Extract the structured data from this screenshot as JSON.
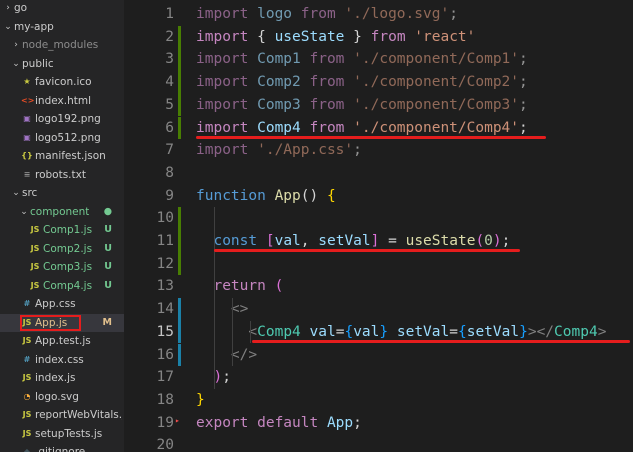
{
  "explorer": {
    "items": [
      {
        "label": "go",
        "type": "folder",
        "depth": 0,
        "expanded": false,
        "color": "#cccccc"
      },
      {
        "label": "my-app",
        "type": "folder",
        "depth": 0,
        "expanded": true,
        "color": "#cccccc"
      },
      {
        "label": "node_modules",
        "type": "folder",
        "depth": 1,
        "expanded": false,
        "color": "#8c8c8c"
      },
      {
        "label": "public",
        "type": "folder",
        "depth": 1,
        "expanded": true,
        "color": "#cccccc"
      },
      {
        "label": "favicon.ico",
        "type": "file",
        "icon": "star-icon",
        "glyph": "★",
        "iconColor": "#cbcb41",
        "depth": 2,
        "color": "#cccccc"
      },
      {
        "label": "index.html",
        "type": "file",
        "icon": "html-icon",
        "glyph": "<>",
        "iconColor": "#e44d26",
        "depth": 2,
        "color": "#cccccc"
      },
      {
        "label": "logo192.png",
        "type": "file",
        "icon": "image-icon",
        "glyph": "▣",
        "iconColor": "#a074c4",
        "depth": 2,
        "color": "#cccccc"
      },
      {
        "label": "logo512.png",
        "type": "file",
        "icon": "image-icon",
        "glyph": "▣",
        "iconColor": "#a074c4",
        "depth": 2,
        "color": "#cccccc"
      },
      {
        "label": "manifest.json",
        "type": "file",
        "icon": "json-icon",
        "glyph": "{}",
        "iconColor": "#cbcb41",
        "depth": 2,
        "color": "#cccccc"
      },
      {
        "label": "robots.txt",
        "type": "file",
        "icon": "text-icon",
        "glyph": "≡",
        "iconColor": "#8c8c8c",
        "depth": 2,
        "color": "#cccccc"
      },
      {
        "label": "src",
        "type": "folder",
        "depth": 1,
        "expanded": true,
        "color": "#cccccc"
      },
      {
        "label": "component",
        "type": "folder",
        "depth": 2,
        "expanded": true,
        "color": "#73c991",
        "badge": "●",
        "badgeColor": "#73c991"
      },
      {
        "label": "Comp1.js",
        "type": "file",
        "icon": "js-icon",
        "glyph": "JS",
        "iconColor": "#cbcb41",
        "depth": 3,
        "color": "#73c991",
        "badge": "U",
        "badgeColor": "#73c991"
      },
      {
        "label": "Comp2.js",
        "type": "file",
        "icon": "js-icon",
        "glyph": "JS",
        "iconColor": "#cbcb41",
        "depth": 3,
        "color": "#73c991",
        "badge": "U",
        "badgeColor": "#73c991"
      },
      {
        "label": "Comp3.js",
        "type": "file",
        "icon": "js-icon",
        "glyph": "JS",
        "iconColor": "#cbcb41",
        "depth": 3,
        "color": "#73c991",
        "badge": "U",
        "badgeColor": "#73c991"
      },
      {
        "label": "Comp4.js",
        "type": "file",
        "icon": "js-icon",
        "glyph": "JS",
        "iconColor": "#cbcb41",
        "depth": 3,
        "color": "#73c991",
        "badge": "U",
        "badgeColor": "#73c991"
      },
      {
        "label": "App.css",
        "type": "file",
        "icon": "css-icon",
        "glyph": "#",
        "iconColor": "#519aba",
        "depth": 2,
        "color": "#cccccc"
      },
      {
        "label": "App.js",
        "type": "file",
        "icon": "js-icon",
        "glyph": "JS",
        "iconColor": "#cbcb41",
        "depth": 2,
        "color": "#e2c08d",
        "badge": "M",
        "badgeColor": "#e2c08d",
        "selected": true,
        "highlight": true
      },
      {
        "label": "App.test.js",
        "type": "file",
        "icon": "js-icon",
        "glyph": "JS",
        "iconColor": "#cbcb41",
        "depth": 2,
        "color": "#cccccc"
      },
      {
        "label": "index.css",
        "type": "file",
        "icon": "css-icon",
        "glyph": "#",
        "iconColor": "#519aba",
        "depth": 2,
        "color": "#cccccc"
      },
      {
        "label": "index.js",
        "type": "file",
        "icon": "js-icon",
        "glyph": "JS",
        "iconColor": "#cbcb41",
        "depth": 2,
        "color": "#cccccc"
      },
      {
        "label": "logo.svg",
        "type": "file",
        "icon": "svg-icon",
        "glyph": "◔",
        "iconColor": "#ffb13b",
        "depth": 2,
        "color": "#cccccc"
      },
      {
        "label": "reportWebVitals.js",
        "type": "file",
        "icon": "js-icon",
        "glyph": "JS",
        "iconColor": "#cbcb41",
        "depth": 2,
        "color": "#cccccc"
      },
      {
        "label": "setupTests.js",
        "type": "file",
        "icon": "js-icon",
        "glyph": "JS",
        "iconColor": "#cbcb41",
        "depth": 2,
        "color": "#cccccc"
      },
      {
        "label": ".gitignore",
        "type": "file",
        "icon": "git-icon",
        "glyph": "◆",
        "iconColor": "#41535b",
        "depth": 2,
        "color": "#cccccc"
      }
    ]
  },
  "editor": {
    "current_line": 15,
    "lines": [
      {
        "n": "1",
        "tokens": [
          [
            "import ",
            "kw",
            "0.65"
          ],
          [
            "logo",
            "id",
            "0.65"
          ],
          [
            " from ",
            "kw",
            "0.65"
          ],
          [
            "'./logo.svg'",
            "str",
            "0.65"
          ],
          [
            ";",
            "pl",
            "0.65"
          ]
        ]
      },
      {
        "n": "2",
        "gutter": "added",
        "tokens": [
          [
            "import ",
            "kw"
          ],
          [
            "{ ",
            "pl"
          ],
          [
            "useState",
            "id"
          ],
          [
            " } ",
            "pl"
          ],
          [
            "from ",
            "kw"
          ],
          [
            "'react'",
            "str"
          ]
        ]
      },
      {
        "n": "3",
        "gutter": "added",
        "tokens": [
          [
            "import ",
            "kw",
            "0.65"
          ],
          [
            "Comp1",
            "id",
            "0.65"
          ],
          [
            " from ",
            "kw",
            "0.65"
          ],
          [
            "'./component/Comp1'",
            "str",
            "0.65"
          ],
          [
            ";",
            "pl",
            "0.65"
          ]
        ]
      },
      {
        "n": "4",
        "gutter": "added",
        "tokens": [
          [
            "import ",
            "kw",
            "0.65"
          ],
          [
            "Comp2",
            "id",
            "0.65"
          ],
          [
            " from ",
            "kw",
            "0.65"
          ],
          [
            "'./component/Comp2'",
            "str",
            "0.65"
          ],
          [
            ";",
            "pl",
            "0.65"
          ]
        ]
      },
      {
        "n": "5",
        "gutter": "added",
        "tokens": [
          [
            "import ",
            "kw",
            "0.65"
          ],
          [
            "Comp3",
            "id",
            "0.65"
          ],
          [
            " from ",
            "kw",
            "0.65"
          ],
          [
            "'./component/Comp3'",
            "str",
            "0.65"
          ],
          [
            ";",
            "pl",
            "0.65"
          ]
        ]
      },
      {
        "n": "6",
        "gutter": "added",
        "tokens": [
          [
            "import ",
            "kw"
          ],
          [
            "Comp4",
            "id"
          ],
          [
            " from ",
            "kw"
          ],
          [
            "'./component/Comp4'",
            "str"
          ],
          [
            ";",
            "pl"
          ]
        ]
      },
      {
        "n": "7",
        "tokens": [
          [
            "import ",
            "kw",
            "0.65"
          ],
          [
            "'./App.css'",
            "str",
            "0.65"
          ],
          [
            ";",
            "pl",
            "0.65"
          ]
        ]
      },
      {
        "n": "8",
        "tokens": []
      },
      {
        "n": "9",
        "tokens": [
          [
            "function ",
            "kw2"
          ],
          [
            "App",
            "fn"
          ],
          [
            "() ",
            "pl"
          ],
          [
            "{",
            "br1"
          ]
        ]
      },
      {
        "n": "10",
        "gutter": "added",
        "tokens": []
      },
      {
        "n": "11",
        "gutter": "added",
        "tokens": [
          [
            "  ",
            "pl"
          ],
          [
            "const ",
            "kw2"
          ],
          [
            "[",
            "br2"
          ],
          [
            "val",
            "id"
          ],
          [
            ", ",
            "pl"
          ],
          [
            "setVal",
            "id"
          ],
          [
            "]",
            "br2"
          ],
          [
            " = ",
            "pl"
          ],
          [
            "useState",
            "fn"
          ],
          [
            "(",
            "br2"
          ],
          [
            "0",
            "num"
          ],
          [
            ")",
            "br2"
          ],
          [
            ";",
            "pl"
          ]
        ]
      },
      {
        "n": "12",
        "gutter": "added",
        "tokens": []
      },
      {
        "n": "13",
        "tokens": [
          [
            "  ",
            "pl"
          ],
          [
            "return ",
            "kw"
          ],
          [
            "(",
            "br2"
          ]
        ]
      },
      {
        "n": "14",
        "gutter": "modified",
        "tokens": [
          [
            "    ",
            "pl"
          ],
          [
            "<>",
            "ang"
          ]
        ]
      },
      {
        "n": "15",
        "gutter": "modified",
        "tokens": [
          [
            "      ",
            "pl"
          ],
          [
            "<",
            "ang"
          ],
          [
            "Comp4 ",
            "tag"
          ],
          [
            "val",
            "id"
          ],
          [
            "=",
            "pl"
          ],
          [
            "{",
            "br3"
          ],
          [
            "val",
            "id"
          ],
          [
            "}",
            "br3"
          ],
          [
            " ",
            "pl"
          ],
          [
            "setVal",
            "id"
          ],
          [
            "=",
            "pl"
          ],
          [
            "{",
            "br3"
          ],
          [
            "setVal",
            "id"
          ],
          [
            "}",
            "br3"
          ],
          [
            "></",
            "ang"
          ],
          [
            "Comp4",
            "tag"
          ],
          [
            ">",
            "ang"
          ]
        ]
      },
      {
        "n": "16",
        "gutter": "modified",
        "tokens": [
          [
            "    ",
            "pl"
          ],
          [
            "</>",
            "ang"
          ]
        ]
      },
      {
        "n": "17",
        "tokens": [
          [
            "  ",
            "pl"
          ],
          [
            ")",
            "br2"
          ],
          [
            ";",
            "pl"
          ]
        ]
      },
      {
        "n": "18",
        "tokens": [
          [
            "}",
            "br1"
          ]
        ]
      },
      {
        "n": "19",
        "gutter": "deleted",
        "tokens": [
          [
            "export ",
            "kw"
          ],
          [
            "default ",
            "kw"
          ],
          [
            "App",
            "id"
          ],
          [
            ";",
            "pl"
          ]
        ]
      },
      {
        "n": "20",
        "tokens": []
      }
    ]
  },
  "colors": {
    "added": "#487e02",
    "modified": "#1b81a8",
    "deleted": "#f14c4c",
    "annotation": "#e51d1d",
    "selected_row": "#37373d"
  }
}
